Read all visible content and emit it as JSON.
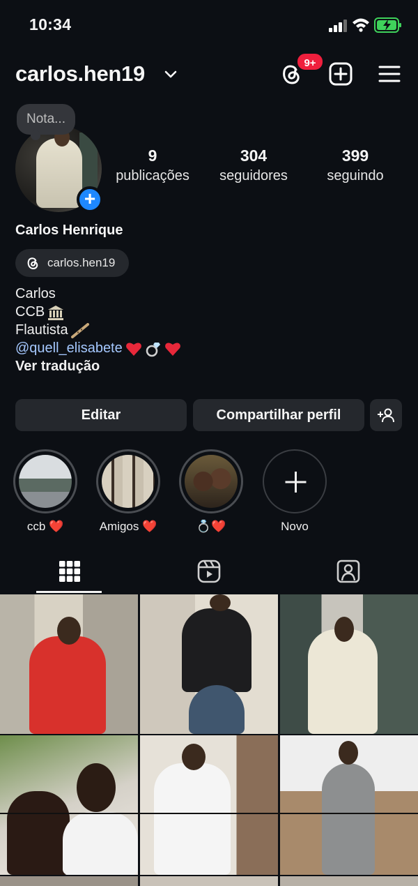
{
  "status": {
    "time": "10:34"
  },
  "header": {
    "username": "carlos.hen19",
    "badge": "9+"
  },
  "profile": {
    "note": "Nota...",
    "stats": [
      {
        "value": "9",
        "label": "publicações"
      },
      {
        "value": "304",
        "label": "seguidores"
      },
      {
        "value": "399",
        "label": "seguindo"
      }
    ],
    "full_name": "Carlos Henrique",
    "threads_handle": "carlos.hen19",
    "bio": {
      "line1": "Carlos",
      "line2": "CCB",
      "line3": "Flautista",
      "mention": "@quell_elisabete",
      "translate": "Ver tradução"
    }
  },
  "actions": {
    "edit": "Editar",
    "share": "Compartilhar perfil"
  },
  "highlights": [
    {
      "label": "ccb ❤️"
    },
    {
      "label": "Amigos ❤️"
    },
    {
      "label": "💍❤️"
    },
    {
      "label": "Novo"
    }
  ],
  "colors": {
    "background": "#0c0f14",
    "button": "#25282d",
    "mention": "#a5c8ff",
    "badge": "#ef1f3d",
    "accent": "#1e88ff"
  }
}
